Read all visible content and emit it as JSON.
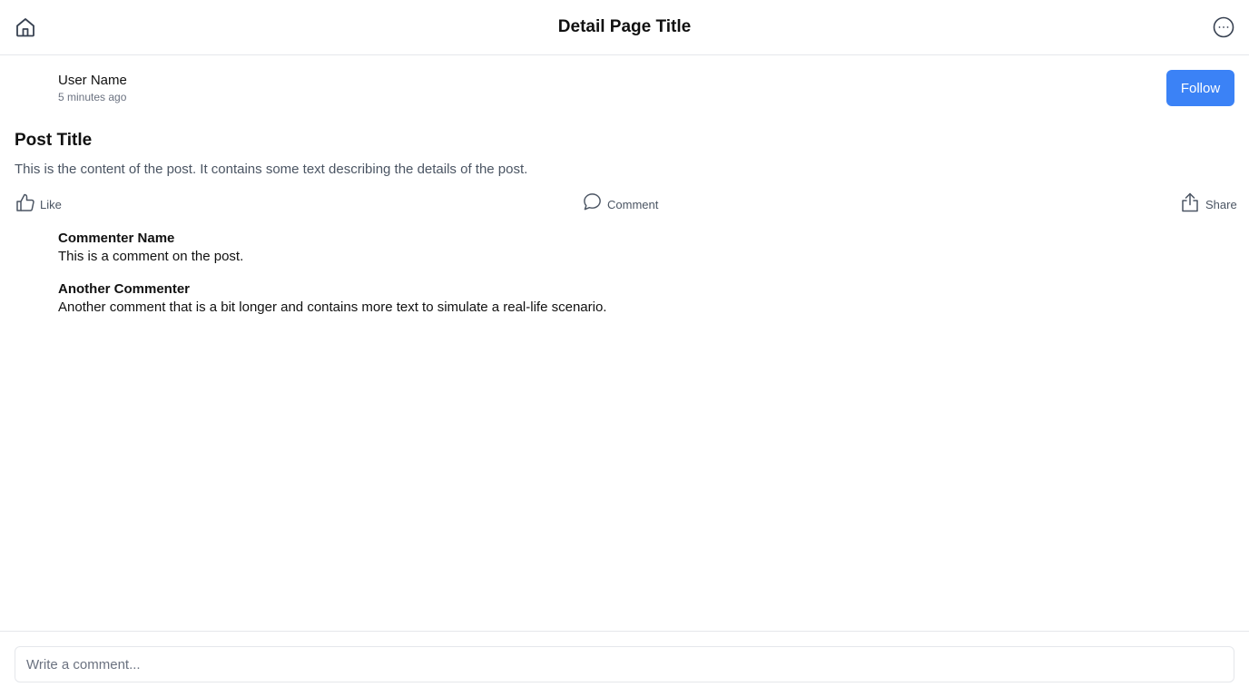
{
  "header": {
    "title": "Detail Page Title",
    "left_icon": "home-icon",
    "right_icon": "more-options-icon"
  },
  "post": {
    "author": {
      "name": "User Name",
      "time": "5 minutes ago"
    },
    "follow_label": "Follow",
    "title": "Post Title",
    "content": "This is the content of the post. It contains some text describing the details of the post.",
    "actions": {
      "like": {
        "label": "Like",
        "icon": "thumbs-up-icon"
      },
      "comment": {
        "label": "Comment",
        "icon": "speech-bubble-icon"
      },
      "share": {
        "label": "Share",
        "icon": "share-icon"
      }
    }
  },
  "comments": [
    {
      "author": "Commenter Name",
      "text": "This is a comment on the post."
    },
    {
      "author": "Another Commenter",
      "text": "Another comment that is a bit longer and contains more text to simulate a real-life scenario."
    }
  ],
  "comment_input": {
    "placeholder": "Write a comment..."
  },
  "colors": {
    "accent": "#3b82f6",
    "muted_text": "#6b7280",
    "divider": "#e5e7eb"
  }
}
